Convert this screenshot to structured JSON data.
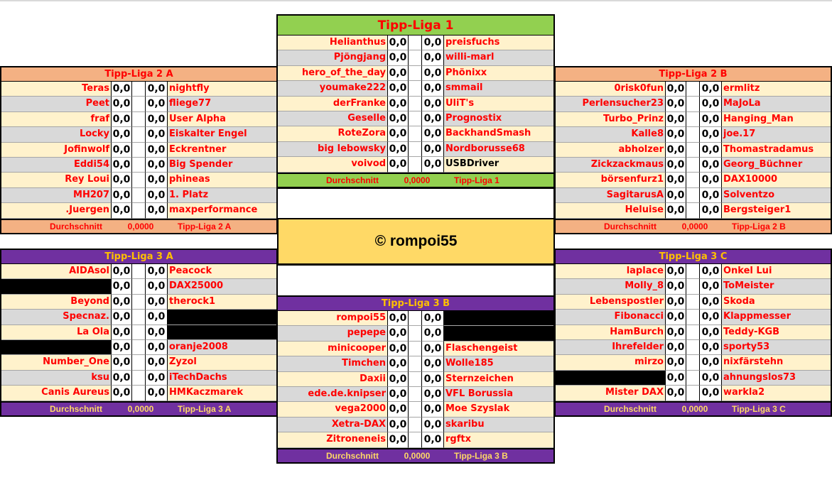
{
  "copyright": "© rompoi55",
  "average_label": "Durchschnitt",
  "leagues": {
    "liga1": {
      "title": "Tipp-Liga 1",
      "average": "0,0000",
      "color": "#92d050",
      "rows": [
        {
          "home": "Helianthus",
          "hs": "0,0",
          "as": "0,0",
          "away": "preisfuchs"
        },
        {
          "home": "Pjöngjang",
          "hs": "0,0",
          "as": "0,0",
          "away": "willi-marl"
        },
        {
          "home": "hero_of_the_day",
          "hs": "0,0",
          "as": "0,0",
          "away": "Phönixx"
        },
        {
          "home": "youmake222",
          "hs": "0,0",
          "as": "0,0",
          "away": "smmail"
        },
        {
          "home": "derFranke",
          "hs": "0,0",
          "as": "0,0",
          "away": "UliT's"
        },
        {
          "home": "Geselle",
          "hs": "0,0",
          "as": "0,0",
          "away": "Prognostix"
        },
        {
          "home": "RoteZora",
          "hs": "0,0",
          "as": "0,0",
          "away": "BackhandSmash"
        },
        {
          "home": "big lebowsky",
          "hs": "0,0",
          "as": "0,0",
          "away": "Nordborusse68"
        },
        {
          "home": "voivod",
          "hs": "0,0",
          "as": "0,0",
          "away": "USBDriver"
        }
      ]
    },
    "liga2a": {
      "title": "Tipp-Liga 2 A",
      "average": "0,0000",
      "color": "#f4b183",
      "rows": [
        {
          "home": "Teras",
          "hs": "0,0",
          "as": "0,0",
          "away": "nightfly"
        },
        {
          "home": "Peet",
          "hs": "0,0",
          "as": "0,0",
          "away": "fliege77"
        },
        {
          "home": "fraf",
          "hs": "0,0",
          "as": "0,0",
          "away": "User Alpha"
        },
        {
          "home": "Locky",
          "hs": "0,0",
          "as": "0,0",
          "away": "Eiskalter Engel"
        },
        {
          "home": "Jofinwolf",
          "hs": "0,0",
          "as": "0,0",
          "away": "Eckrentner"
        },
        {
          "home": "Eddi54",
          "hs": "0,0",
          "as": "0,0",
          "away": "Big Spender"
        },
        {
          "home": "Rey Loui",
          "hs": "0,0",
          "as": "0,0",
          "away": "phineas"
        },
        {
          "home": "MH207",
          "hs": "0,0",
          "as": "0,0",
          "away": "1. Platz"
        },
        {
          "home": ".Juergen",
          "hs": "0,0",
          "as": "0,0",
          "away": "maxperformance"
        }
      ]
    },
    "liga2b": {
      "title": "Tipp-Liga 2 B",
      "average": "0,0000",
      "color": "#f4b183",
      "rows": [
        {
          "home": "0risk0fun",
          "hs": "0,0",
          "as": "0,0",
          "away": "ermlitz"
        },
        {
          "home": "Perlensucher23",
          "hs": "0,0",
          "as": "0,0",
          "away": "MaJoLa"
        },
        {
          "home": "Turbo_Prinz",
          "hs": "0,0",
          "as": "0,0",
          "away": "Hanging_Man"
        },
        {
          "home": "Kalle8",
          "hs": "0,0",
          "as": "0,0",
          "away": "joe.17"
        },
        {
          "home": "abholzer",
          "hs": "0,0",
          "as": "0,0",
          "away": "Thomastradamus"
        },
        {
          "home": "Zickzackmaus",
          "hs": "0,0",
          "as": "0,0",
          "away": "Georg_Büchner"
        },
        {
          "home": "börsenfurz1",
          "hs": "0,0",
          "as": "0,0",
          "away": "DAX10000"
        },
        {
          "home": "SagitarusA",
          "hs": "0,0",
          "as": "0,0",
          "away": "Solventzo"
        },
        {
          "home": "Heluise",
          "hs": "0,0",
          "as": "0,0",
          "away": "Bergsteiger1"
        }
      ]
    },
    "liga3a": {
      "title": "Tipp-Liga 3 A",
      "average": "0,0000",
      "color": "#7030a0",
      "rows": [
        {
          "home": "AIDAsol",
          "hs": "0,0",
          "as": "0,0",
          "away": "Peacock"
        },
        {
          "home": "",
          "hs": "0,0",
          "as": "0,0",
          "away": "DAX25000"
        },
        {
          "home": "Beyond",
          "hs": "0,0",
          "as": "0,0",
          "away": "therock1"
        },
        {
          "home": "Specnaz.",
          "hs": "0,0",
          "as": "0,0",
          "away": ""
        },
        {
          "home": "La Ola",
          "hs": "0,0",
          "as": "0,0",
          "away": ""
        },
        {
          "home": "",
          "hs": "0,0",
          "as": "0,0",
          "away": "oranje2008"
        },
        {
          "home": "Number_One",
          "hs": "0,0",
          "as": "0,0",
          "away": "Zyzol"
        },
        {
          "home": "ksu",
          "hs": "0,0",
          "as": "0,0",
          "away": "iTechDachs"
        },
        {
          "home": "Canis Aureus",
          "hs": "0,0",
          "as": "0,0",
          "away": "HMKaczmarek"
        }
      ]
    },
    "liga3b": {
      "title": "Tipp-Liga 3 B",
      "average": "0,0000",
      "color": "#7030a0",
      "rows": [
        {
          "home": "rompoi55",
          "hs": "0,0",
          "as": "0,0",
          "away": ""
        },
        {
          "home": "pepepe",
          "hs": "0,0",
          "as": "0,0",
          "away": ""
        },
        {
          "home": "minicooper",
          "hs": "0,0",
          "as": "0,0",
          "away": "Flaschengeist"
        },
        {
          "home": "Timchen",
          "hs": "0,0",
          "as": "0,0",
          "away": "Wolle185"
        },
        {
          "home": "Daxii",
          "hs": "0,0",
          "as": "0,0",
          "away": "Sternzeichen"
        },
        {
          "home": "ede.de.knipser",
          "hs": "0,0",
          "as": "0,0",
          "away": "VFL Borussia"
        },
        {
          "home": "vega2000",
          "hs": "0,0",
          "as": "0,0",
          "away": "Moe Szyslak"
        },
        {
          "home": "Xetra-DAX",
          "hs": "0,0",
          "as": "0,0",
          "away": "skaribu"
        },
        {
          "home": "Zitroneneis",
          "hs": "0,0",
          "as": "0,0",
          "away": "rgftx"
        }
      ]
    },
    "liga3c": {
      "title": "Tipp-Liga 3 C",
      "average": "0,0000",
      "color": "#7030a0",
      "rows": [
        {
          "home": "laplace",
          "hs": "0,0",
          "as": "0,0",
          "away": "Onkel Lui"
        },
        {
          "home": "Molly_8",
          "hs": "0,0",
          "as": "0,0",
          "away": "ToMeister"
        },
        {
          "home": "Lebenspostler",
          "hs": "0,0",
          "as": "0,0",
          "away": "Skoda"
        },
        {
          "home": "Fibonacci",
          "hs": "0,0",
          "as": "0,0",
          "away": "Klappmesser"
        },
        {
          "home": "HamBurch",
          "hs": "0,0",
          "as": "0,0",
          "away": "Teddy-KGB"
        },
        {
          "home": "Ihrefelder",
          "hs": "0,0",
          "as": "0,0",
          "away": "sporty53"
        },
        {
          "home": "mirzo",
          "hs": "0,0",
          "as": "0,0",
          "away": "nixfärstehn"
        },
        {
          "home": "",
          "hs": "0,0",
          "as": "0,0",
          "away": "ahnungslos73"
        },
        {
          "home": "Mister DAX",
          "hs": "0,0",
          "as": "0,0",
          "away": "warkla2"
        }
      ]
    }
  }
}
